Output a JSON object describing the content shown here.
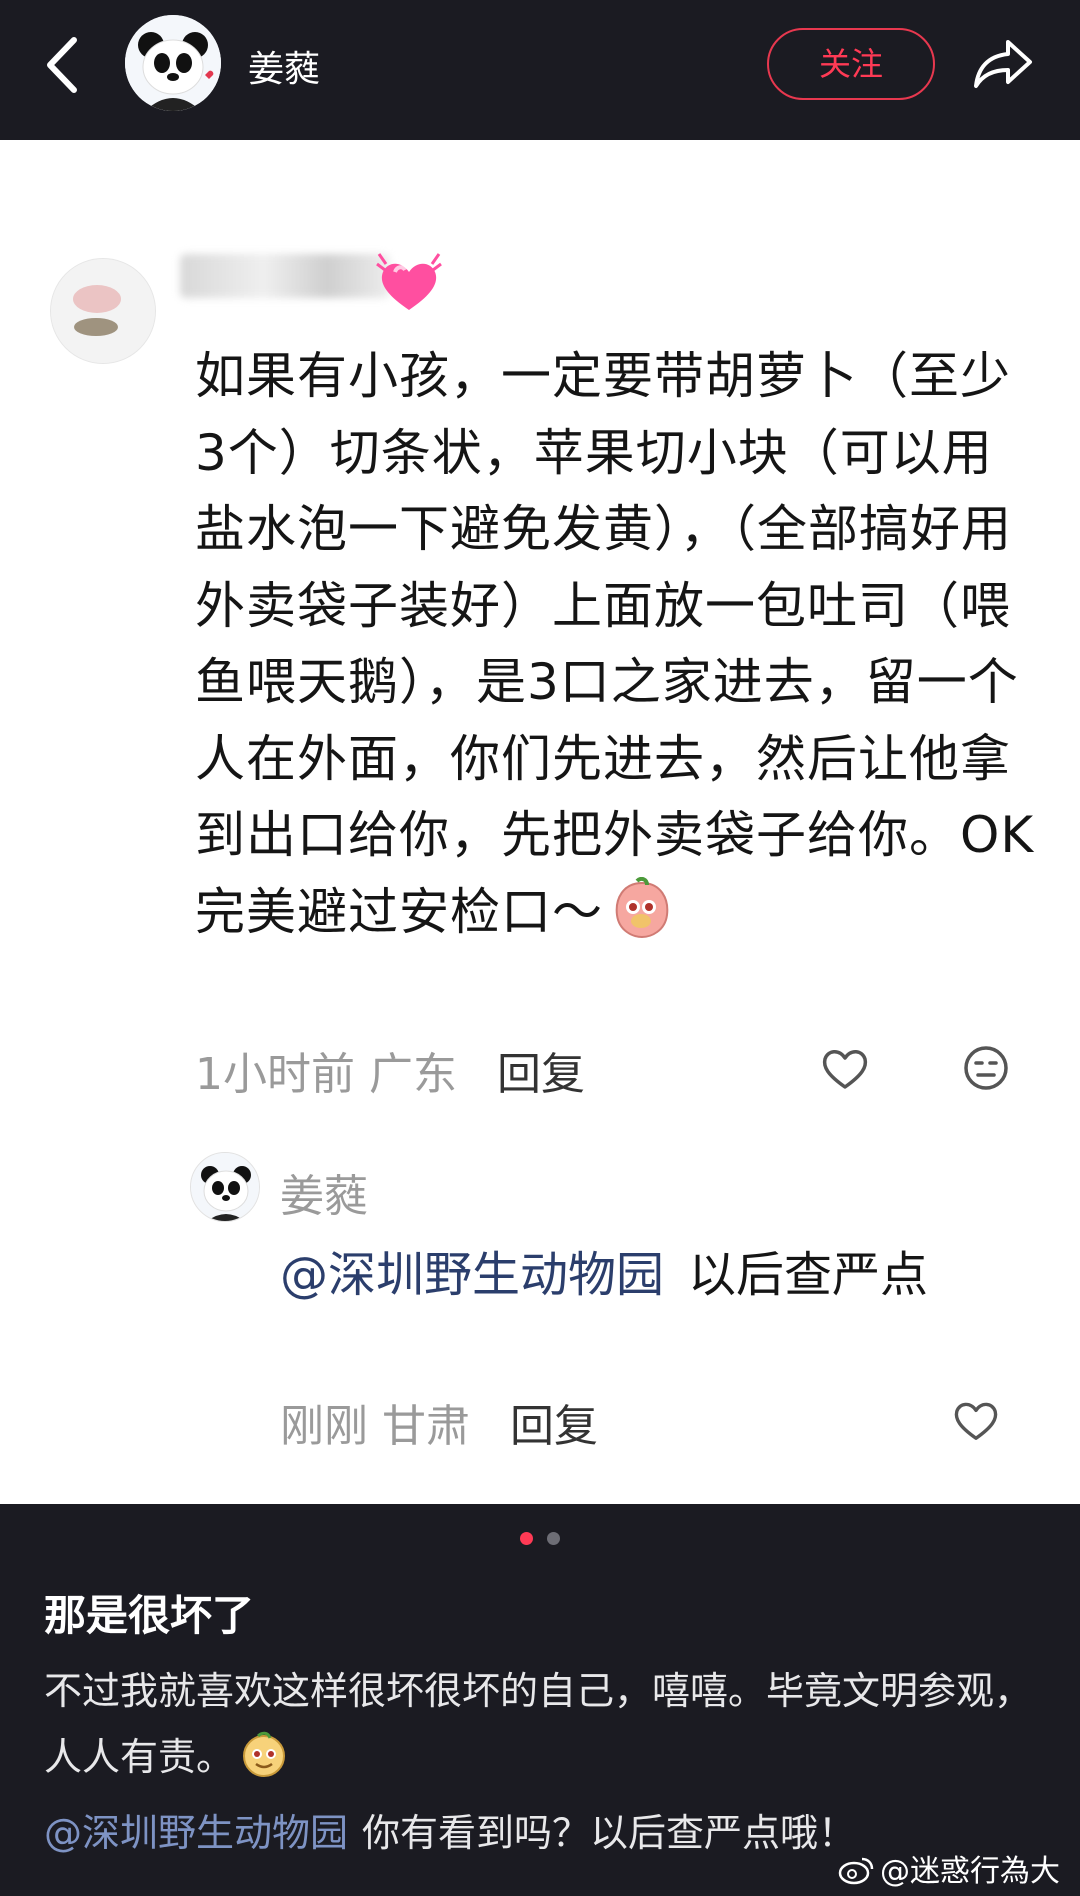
{
  "header": {
    "username": "姜蕤",
    "follow_label": "关注",
    "colors": {
      "background": "#1b1b22",
      "follow": "#e8384f"
    }
  },
  "comment": {
    "author_obscured": true,
    "text": "如果有小孩，一定要带胡萝卜（至少3个）切条状，苹果切小块（可以用盐水泡一下避免发黄），（全部搞好用外卖袋子装好）上面放一包吐司（喂鱼喂天鹅），是3口之家进去，留一个人在外面，你们先进去，然后让他拿到出口给你，先把外卖袋子给你。OK完美避过安检口～",
    "time": "1小时前",
    "location": "广东",
    "reply_label": "回复",
    "icons": [
      "pink-heart-emoji",
      "peach-emoji",
      "like-heart-icon",
      "emoji-face-icon"
    ]
  },
  "reply": {
    "author": "姜蕤",
    "mention": "@深圳野生动物园",
    "text": "以后查严点",
    "time": "刚刚",
    "location": "甘肃",
    "reply_label": "回复"
  },
  "post": {
    "title": "那是很坏了",
    "body": "不过我就喜欢这样很坏很坏的自己，嘻嘻。毕竟文明参观，人人有责。",
    "mention": "@深圳野生动物园",
    "mention_text": "你有看到吗？以后查严点哦！",
    "pagination": {
      "current": 1,
      "total": 2,
      "active_color": "#ff3a55",
      "inactive_color": "#6d6d75"
    }
  },
  "watermark": "@迷惑行為大賞"
}
